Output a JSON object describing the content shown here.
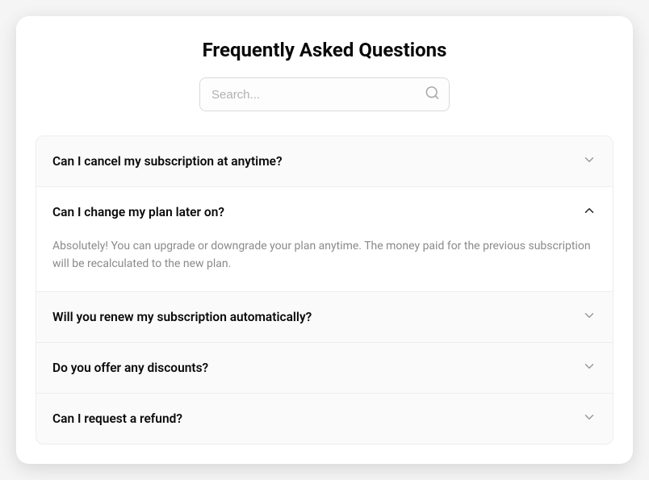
{
  "title": "Frequently Asked Questions",
  "search": {
    "placeholder": "Search...",
    "value": ""
  },
  "faq": {
    "items": [
      {
        "question": "Can I cancel my subscription at anytime?",
        "expanded": false
      },
      {
        "question": "Can I change my plan later on?",
        "expanded": true,
        "answer": "Absolutely! You can upgrade or downgrade your plan anytime. The money paid for the previous subscription will be recalculated to the new plan."
      },
      {
        "question": "Will you renew my subscription automatically?",
        "expanded": false
      },
      {
        "question": "Do you offer any discounts?",
        "expanded": false
      },
      {
        "question": "Can I request a refund?",
        "expanded": false
      }
    ]
  }
}
